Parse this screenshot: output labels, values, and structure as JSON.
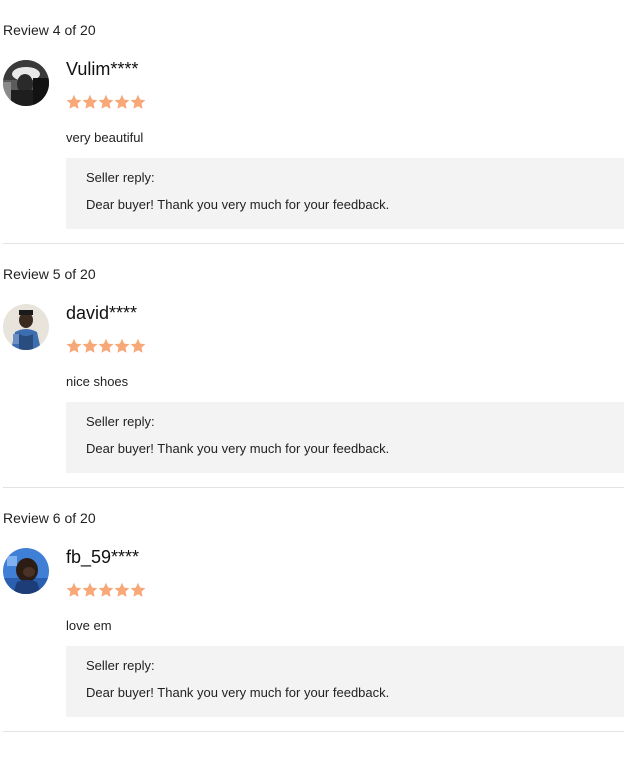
{
  "reviews": [
    {
      "counter": "Review 4 of 20",
      "username": "Vulim****",
      "rating": 5,
      "text": "very beautiful",
      "reply_title": "Seller reply:",
      "reply_text": "Dear buyer! Thank you very much for your feedback."
    },
    {
      "counter": "Review 5 of 20",
      "username": "david****",
      "rating": 5,
      "text": "nice shoes",
      "reply_title": "Seller reply:",
      "reply_text": "Dear buyer! Thank you very much for your feedback."
    },
    {
      "counter": "Review 6 of 20",
      "username": "fb_59****",
      "rating": 5,
      "text": "love em",
      "reply_title": "Seller reply:",
      "reply_text": "Dear buyer! Thank you very much for your feedback."
    }
  ],
  "colors": {
    "star": "#f7a878",
    "reply_bg": "#f3f3f3",
    "divider": "#e2e2e2"
  },
  "icons": {
    "star": "star-icon",
    "avatar": "user-avatar-photo"
  }
}
